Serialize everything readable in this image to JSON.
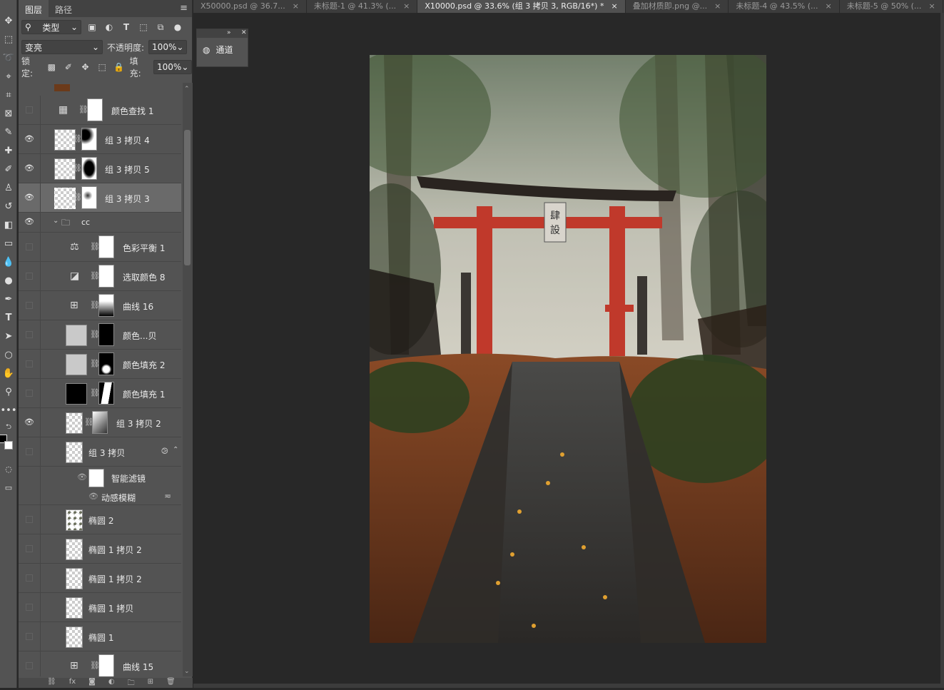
{
  "doc_tabs": [
    {
      "label": "X50000.psd @ 36.7...",
      "close": "×"
    },
    {
      "label": "未标题-1 @ 41.3% (...",
      "close": "×"
    },
    {
      "label": "X10000.psd @ 33.6% (组 3 拷贝 3, RGB/16*) *",
      "close": "×"
    },
    {
      "label": "叠加材质即.png @...",
      "close": "×"
    },
    {
      "label": "未标题-4 @ 43.5% (...",
      "close": "×"
    },
    {
      "label": "未标题-5 @ 50% (...",
      "close": "×"
    }
  ],
  "panel_tabs": {
    "layers": "图层",
    "paths": "路径"
  },
  "filter": {
    "kind": "类型"
  },
  "blend": {
    "mode": "变亮",
    "opacity_label": "不透明度:",
    "opacity": "100%"
  },
  "lock": {
    "label": "锁定:",
    "fill_label": "填充:",
    "fill": "100%"
  },
  "layers": [
    {
      "name": "颜色查找 1",
      "visible": false,
      "type": "adjust",
      "icon": "▦"
    },
    {
      "name": "组 3 拷贝 4",
      "visible": true,
      "type": "pixel-mask"
    },
    {
      "name": "组 3 拷贝 5",
      "visible": true,
      "type": "pixel-mask"
    },
    {
      "name": "组 3 拷贝 3",
      "visible": true,
      "type": "pixel-mask",
      "selected": true
    },
    {
      "name": "cc",
      "visible": true,
      "type": "group"
    },
    {
      "name": "色彩平衡 1",
      "visible": false,
      "type": "adjust",
      "icon": "⚖"
    },
    {
      "name": "选取颜色 8",
      "visible": false,
      "type": "adjust",
      "icon": "◪"
    },
    {
      "name": "曲线 16",
      "visible": false,
      "type": "adjust",
      "icon": "⊞"
    },
    {
      "name": "颜色...贝",
      "visible": false,
      "type": "fill"
    },
    {
      "name": "颜色填充 2",
      "visible": false,
      "type": "fill"
    },
    {
      "name": "颜色填充 1",
      "visible": false,
      "type": "fill-black"
    },
    {
      "name": "组 3 拷贝 2",
      "visible": true,
      "type": "smart-mask"
    },
    {
      "name": "组 3 拷贝",
      "visible": false,
      "type": "smart"
    },
    {
      "name": "智能滤镜",
      "visible": true,
      "type": "smart-filter"
    },
    {
      "name": "动感模糊",
      "visible": true,
      "type": "filter-item"
    },
    {
      "name": "椭圆 2",
      "visible": false,
      "type": "shape"
    },
    {
      "name": "椭圆 1 拷贝 2",
      "visible": false,
      "type": "shape"
    },
    {
      "name": "椭圆 1 拷贝 2",
      "visible": false,
      "type": "shape"
    },
    {
      "name": "椭圆 1 拷贝",
      "visible": false,
      "type": "shape"
    },
    {
      "name": "椭圆 1",
      "visible": false,
      "type": "shape"
    },
    {
      "name": "曲线 15",
      "visible": false,
      "type": "adjust",
      "icon": "⊞"
    }
  ],
  "float_panel": {
    "label": "通道"
  },
  "colors": {
    "panel": "#535353",
    "canvas": "#282828",
    "torii": "#c0392b"
  }
}
